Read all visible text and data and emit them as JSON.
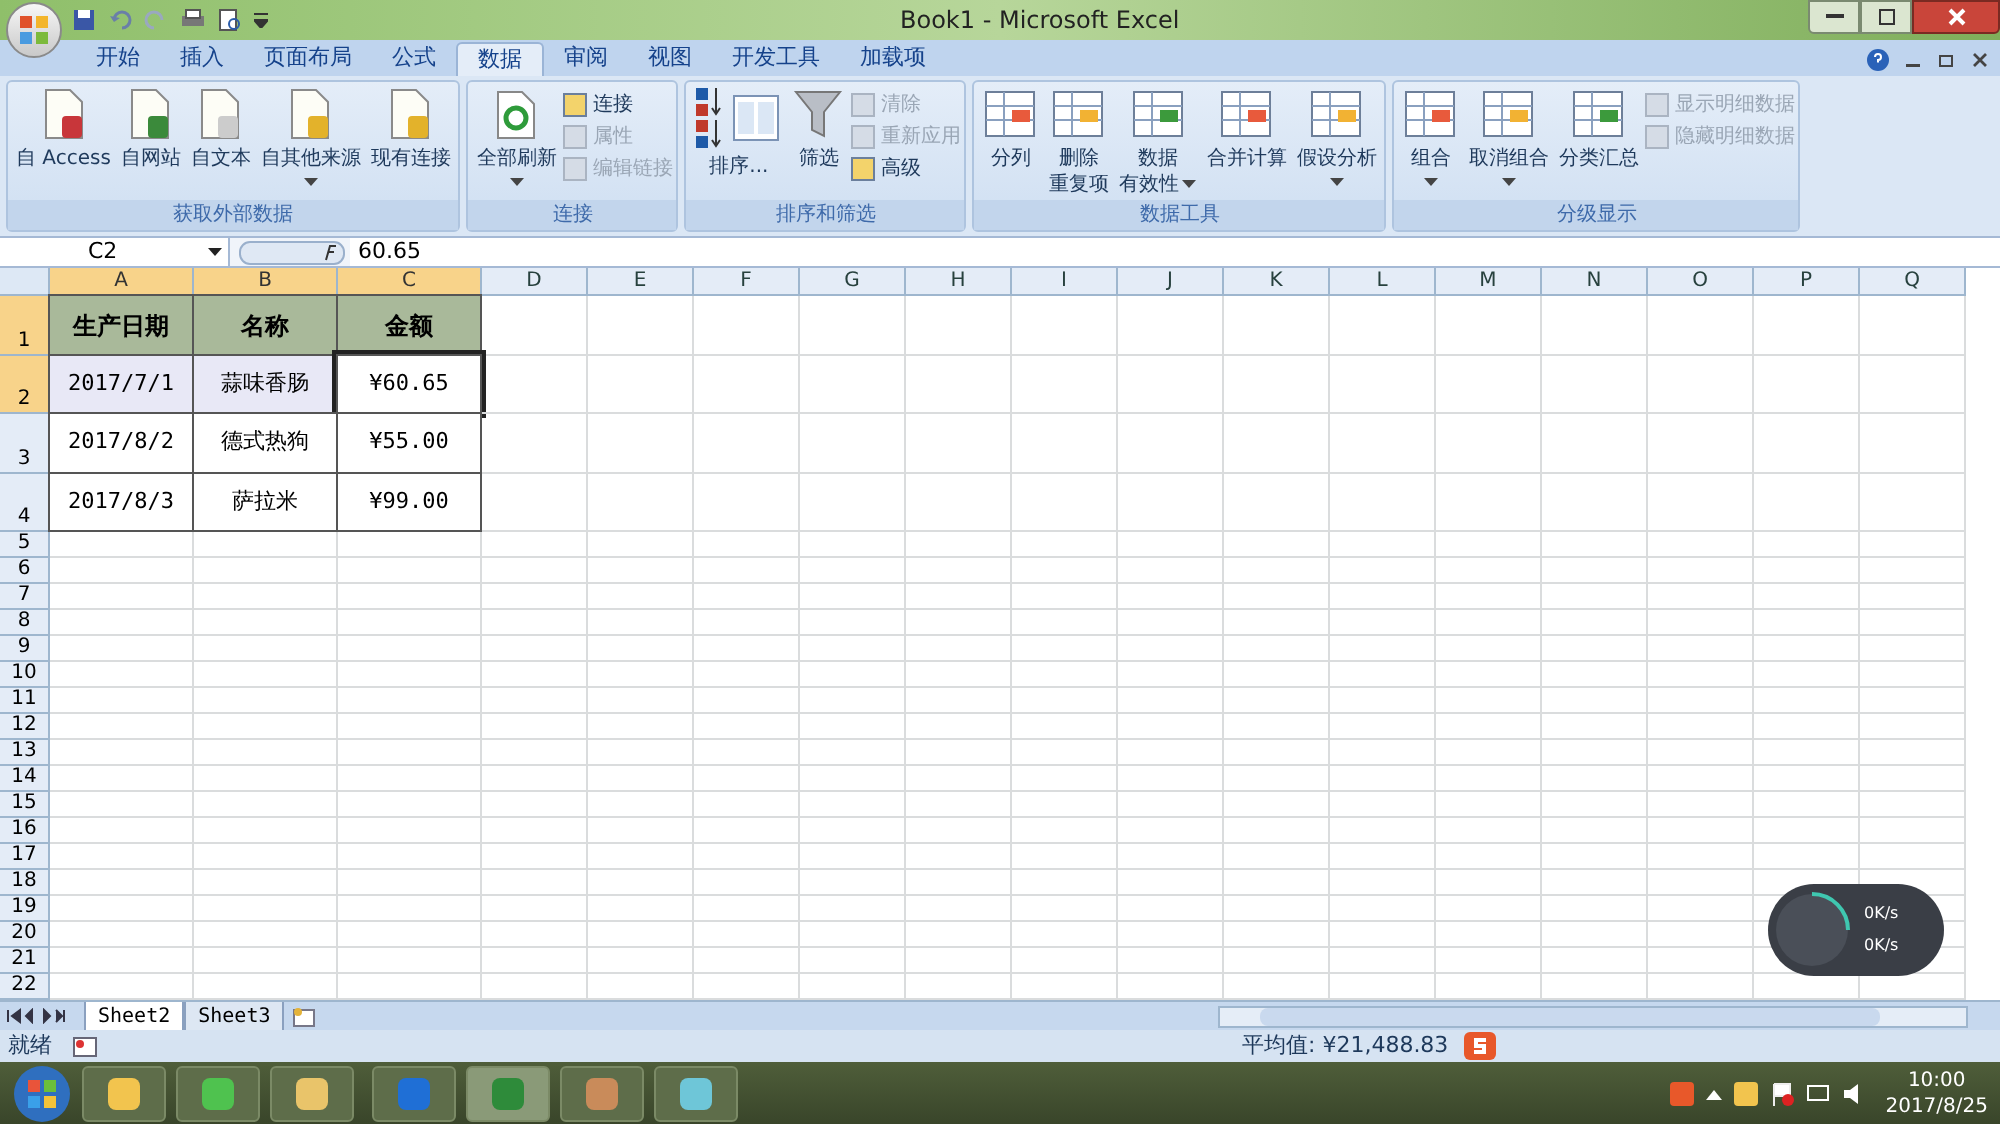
{
  "window": {
    "title": "Book1 - Microsoft Excel"
  },
  "tabs": [
    {
      "label": "开始",
      "selected": false
    },
    {
      "label": "插入",
      "selected": false
    },
    {
      "label": "页面布局",
      "selected": false
    },
    {
      "label": "公式",
      "selected": false
    },
    {
      "label": "数据",
      "selected": true
    },
    {
      "label": "审阅",
      "selected": false
    },
    {
      "label": "视图",
      "selected": false
    },
    {
      "label": "开发工具",
      "selected": false
    },
    {
      "label": "加载项",
      "selected": false
    }
  ],
  "ribbon": {
    "groups": [
      {
        "label": "获取外部数据",
        "items": [
          {
            "kind": "large",
            "label": "自 Access",
            "dropdown": false
          },
          {
            "kind": "large",
            "label": "自网站",
            "dropdown": false
          },
          {
            "kind": "large",
            "label": "自文本",
            "dropdown": false
          },
          {
            "kind": "large",
            "label": "自其他来源",
            "dropdown": true
          },
          {
            "kind": "large",
            "label": "现有连接",
            "dropdown": false
          }
        ]
      },
      {
        "label": "连接",
        "items": [
          {
            "kind": "large",
            "label": "全部刷新",
            "dropdown": true
          },
          {
            "kind": "small",
            "label": "连接",
            "disabled": false
          },
          {
            "kind": "small",
            "label": "属性",
            "disabled": true
          },
          {
            "kind": "small",
            "label": "编辑链接",
            "disabled": true
          }
        ]
      },
      {
        "label": "排序和筛选",
        "items": [
          {
            "kind": "sort",
            "label": "排序..."
          },
          {
            "kind": "large",
            "label": "筛选",
            "dropdown": false
          },
          {
            "kind": "small",
            "label": "清除",
            "disabled": true
          },
          {
            "kind": "small",
            "label": "重新应用",
            "disabled": true
          },
          {
            "kind": "small",
            "label": "高级",
            "disabled": false
          }
        ]
      },
      {
        "label": "数据工具",
        "items": [
          {
            "kind": "large",
            "label": "分列",
            "dropdown": false
          },
          {
            "kind": "large",
            "label": "删除",
            "label2": "重复项",
            "dropdown": false
          },
          {
            "kind": "large",
            "label": "数据",
            "label2": "有效性",
            "dropdown": true
          },
          {
            "kind": "large",
            "label": "合并计算",
            "dropdown": false
          },
          {
            "kind": "large",
            "label": "假设分析",
            "dropdown": true
          }
        ]
      },
      {
        "label": "分级显示",
        "items": [
          {
            "kind": "large",
            "label": "组合",
            "dropdown": true
          },
          {
            "kind": "large",
            "label": "取消组合",
            "dropdown": true
          },
          {
            "kind": "large",
            "label": "分类汇总",
            "dropdown": false
          },
          {
            "kind": "small",
            "label": "显示明细数据",
            "disabled": true
          },
          {
            "kind": "small",
            "label": "隐藏明细数据",
            "disabled": true
          }
        ]
      }
    ]
  },
  "formula_bar": {
    "name_box": "C2",
    "formula": "60.65"
  },
  "sheet": {
    "columns": [
      {
        "label": "A",
        "selected": true
      },
      {
        "label": "B",
        "selected": true
      },
      {
        "label": "C",
        "selected": true
      },
      {
        "label": "D",
        "selected": false
      },
      {
        "label": "E",
        "selected": false
      },
      {
        "label": "F",
        "selected": false
      },
      {
        "label": "G",
        "selected": false
      },
      {
        "label": "H",
        "selected": false
      },
      {
        "label": "I",
        "selected": false
      },
      {
        "label": "J",
        "selected": false
      },
      {
        "label": "K",
        "selected": false
      },
      {
        "label": "L",
        "selected": false
      },
      {
        "label": "M",
        "selected": false
      },
      {
        "label": "N",
        "selected": false
      },
      {
        "label": "O",
        "selected": false
      },
      {
        "label": "P",
        "selected": false
      },
      {
        "label": "Q",
        "selected": false
      }
    ],
    "rows": [
      {
        "label": "1",
        "selected": true,
        "cells": [
          {
            "text": "生产日期",
            "kind": "header"
          },
          {
            "text": "名称",
            "kind": "header"
          },
          {
            "text": "金额",
            "kind": "header"
          }
        ]
      },
      {
        "label": "2",
        "selected": true,
        "cells": [
          {
            "text": "2017/7/1",
            "kind": "data",
            "selected": true
          },
          {
            "text": "蒜味香肠",
            "kind": "data",
            "selected": true
          },
          {
            "text": "¥60.65",
            "kind": "data",
            "selected": false
          }
        ]
      },
      {
        "label": "3",
        "selected": false,
        "cells": [
          {
            "text": "2017/8/2",
            "kind": "data",
            "selected": false
          },
          {
            "text": "德式热狗",
            "kind": "data",
            "selected": false
          },
          {
            "text": "¥55.00",
            "kind": "data",
            "selected": false
          }
        ]
      },
      {
        "label": "4",
        "selected": false,
        "cells": [
          {
            "text": "2017/8/3",
            "kind": "data",
            "selected": false
          },
          {
            "text": "萨拉米",
            "kind": "data",
            "selected": false
          },
          {
            "text": "¥99.00",
            "kind": "data",
            "selected": false
          }
        ]
      },
      {
        "label": "5",
        "selected": false
      },
      {
        "label": "6",
        "selected": false
      },
      {
        "label": "7",
        "selected": false
      },
      {
        "label": "8",
        "selected": false
      },
      {
        "label": "9",
        "selected": false
      },
      {
        "label": "10",
        "selected": false
      },
      {
        "label": "11",
        "selected": false
      },
      {
        "label": "12",
        "selected": false
      },
      {
        "label": "13",
        "selected": false
      },
      {
        "label": "14",
        "selected": false
      },
      {
        "label": "15",
        "selected": false
      },
      {
        "label": "16",
        "selected": false
      },
      {
        "label": "17",
        "selected": false
      },
      {
        "label": "18",
        "selected": false
      },
      {
        "label": "19",
        "selected": false
      },
      {
        "label": "20",
        "selected": false
      },
      {
        "label": "21",
        "selected": false
      },
      {
        "label": "22",
        "selected": false
      }
    ]
  },
  "sheet_tabs": [
    {
      "label": "Sheet2",
      "selected": true
    },
    {
      "label": "Sheet3",
      "selected": false
    }
  ],
  "status_bar": {
    "mode": "就绪",
    "average": "平均值: ¥21,488.83"
  },
  "net_widget": {
    "upload": "0K/s",
    "download": "0K/s"
  },
  "taskbar": {
    "time": "10:00",
    "date": "2017/8/25"
  }
}
